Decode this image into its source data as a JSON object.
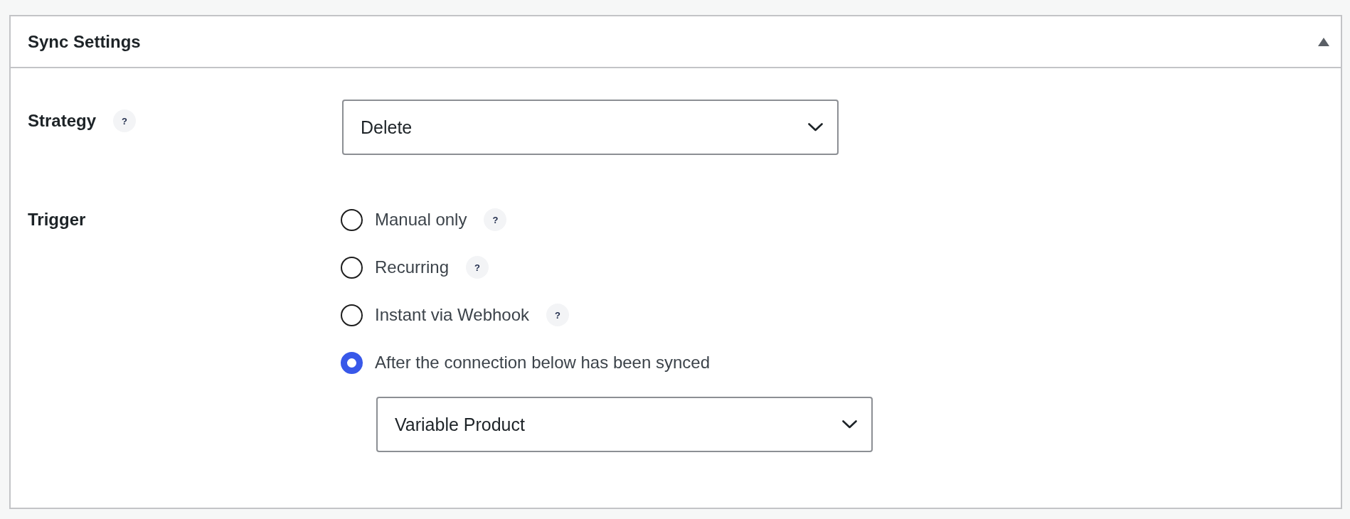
{
  "panel": {
    "title": "Sync Settings",
    "expanded": true
  },
  "fields": [
    {
      "kind": "select",
      "label": "Strategy",
      "help": "?",
      "value": "Delete"
    },
    {
      "kind": "radio_group",
      "label": "Trigger",
      "options": [
        {
          "label": "Manual only",
          "help": "?",
          "selected": false
        },
        {
          "label": "Recurring",
          "help": "?",
          "selected": false
        },
        {
          "label": "Instant via Webhook",
          "help": "?",
          "selected": false
        },
        {
          "label": "After the connection below has been synced",
          "selected": true
        }
      ],
      "connection_select": {
        "value": "Variable Product"
      }
    }
  ]
}
